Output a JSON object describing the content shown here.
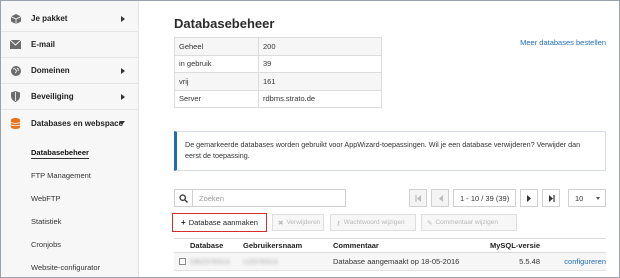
{
  "sidebar": {
    "items": [
      {
        "label": "Je pakket",
        "icon": "package-icon",
        "arrow": "right"
      },
      {
        "label": "E-mail",
        "icon": "envelope-icon",
        "arrow": ""
      },
      {
        "label": "Domeinen",
        "icon": "globe-icon",
        "arrow": "right"
      },
      {
        "label": "Beveiliging",
        "icon": "shield-icon",
        "arrow": "right"
      },
      {
        "label": "Databases en webspace",
        "icon": "database-icon",
        "arrow": "down"
      }
    ],
    "subitems": [
      {
        "label": "Databasebeheer",
        "active": true
      },
      {
        "label": "FTP Management",
        "active": false
      },
      {
        "label": "WebFTP",
        "active": false
      },
      {
        "label": "Statistiek",
        "active": false
      },
      {
        "label": "Cronjobs",
        "active": false
      },
      {
        "label": "Website-configurator",
        "active": false
      }
    ]
  },
  "main": {
    "title": "Databasebeheer",
    "more_link": "Meer databases bestellen",
    "stats": [
      {
        "label": "Geheel",
        "value": "200"
      },
      {
        "label": "in gebruik",
        "value": "39"
      },
      {
        "label": "vrij",
        "value": "161"
      },
      {
        "label": "Server",
        "value": "rdbms.strato.de"
      }
    ],
    "info": "De gemarkeerde databases worden gebruikt voor AppWizard-toepassingen. Wil je een database verwijderen? Verwijder dan eerst de toepassing.",
    "search_placeholder": "Zoeken",
    "pager": {
      "info": "1 - 10 / 39 (39)",
      "per_page": "10"
    },
    "buttons": {
      "create": "Database aanmaken",
      "delete": "Verwijderen",
      "password": "Wachtwoord wijzigen",
      "comment": "Commentaar wijzigen"
    },
    "table": {
      "headers": [
        "Database",
        "Gebruikersnaam",
        "Commentaar",
        "MySQL-versie",
        ""
      ],
      "rows": [
        {
          "database": "DB2578314",
          "user": "U2578314",
          "comment": "Database aangemaakt op 18-05-2016",
          "mysql": "5.5.48",
          "action": "configureren"
        }
      ]
    }
  },
  "colors": {
    "accent": "#1e6fb5",
    "highlight": "#d62d2d",
    "info_border": "#1f6fb2"
  }
}
